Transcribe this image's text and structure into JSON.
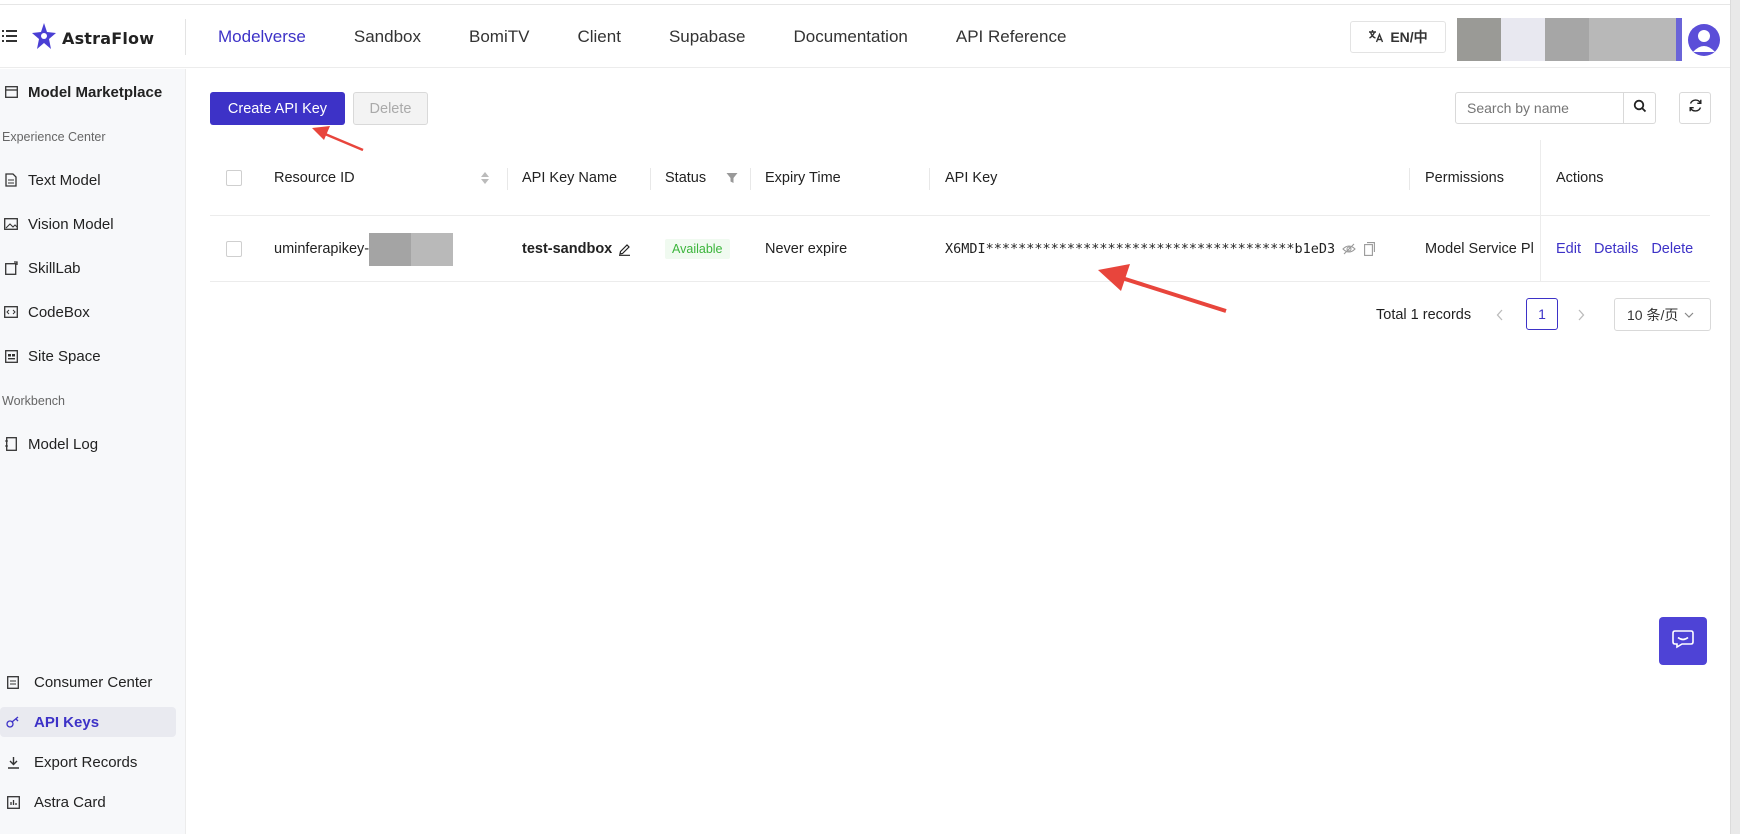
{
  "header": {
    "logo_text": "AstraFlow",
    "nav": [
      "Modelverse",
      "Sandbox",
      "BomiTV",
      "Client",
      "Supabase",
      "Documentation",
      "API Reference"
    ],
    "active_nav": "Modelverse",
    "lang_label": "EN/中"
  },
  "sidebar": {
    "top_item": "Model Marketplace",
    "section_experience": "Experience Center",
    "experience_items": [
      "Text Model",
      "Vision Model",
      "SkillLab",
      "CodeBox",
      "Site Space"
    ],
    "section_workbench": "Workbench",
    "workbench_items": [
      "Model Log"
    ],
    "bottom_items": [
      "Consumer Center",
      "API Keys",
      "Export Records",
      "Astra Card"
    ],
    "active_item": "API Keys"
  },
  "toolbar": {
    "create_label": "Create API Key",
    "delete_label": "Delete",
    "search_placeholder": "Search by name"
  },
  "table": {
    "columns": [
      "Resource ID",
      "API Key Name",
      "Status",
      "Expiry Time",
      "API Key",
      "Permissions",
      "Actions"
    ],
    "rows": [
      {
        "resource_id": "uminferapikey-",
        "name": "test-sandbox",
        "status": "Available",
        "expiry": "Never expire",
        "api_key": "X6MDI**************************************b1eD3",
        "permissions": "Model Service Pl",
        "actions": [
          "Edit",
          "Details",
          "Delete"
        ]
      }
    ]
  },
  "pagination": {
    "total_label": "Total 1 records",
    "current_page": "1",
    "page_size": "10 条/页"
  },
  "colors": {
    "accent": "#3d32c7",
    "status_green": "#3bb53b",
    "annotation_red": "#e8453c"
  }
}
